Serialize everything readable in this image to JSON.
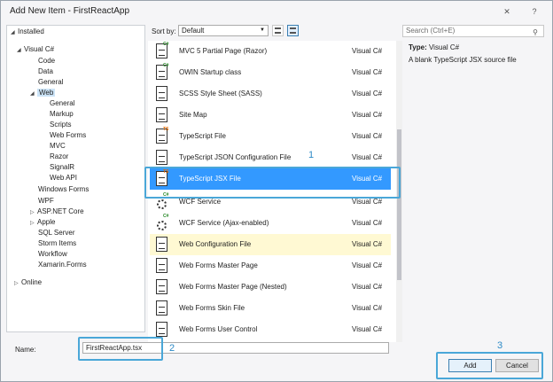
{
  "window": {
    "title": "Add New Item - FirstReactApp",
    "close_icon": "close-icon",
    "help_label": "?"
  },
  "tree": {
    "installed": "Installed",
    "visual_csharp": "Visual C#",
    "items_level2": [
      "Code",
      "Data",
      "General"
    ],
    "web": "Web",
    "web_children": [
      "General",
      "Markup",
      "Scripts",
      "Web Forms",
      "MVC",
      "Razor",
      "SignalR",
      "Web API"
    ],
    "items_after_web": [
      "Windows Forms",
      "WPF"
    ],
    "asp_net_core": "ASP.NET Core",
    "apple": "Apple",
    "items_tail": [
      "SQL Server",
      "Storm Items",
      "Workflow",
      "Xamarin.Forms"
    ],
    "online": "Online"
  },
  "toolbar": {
    "sort_label": "Sort by:",
    "sort_value": "Default"
  },
  "templates": [
    {
      "name": "MVC 5 Partial Page (Razor)",
      "lang": "Visual C#"
    },
    {
      "name": "OWIN Startup class",
      "lang": "Visual C#"
    },
    {
      "name": "SCSS Style Sheet (SASS)",
      "lang": "Visual C#"
    },
    {
      "name": "Site Map",
      "lang": "Visual C#"
    },
    {
      "name": "TypeScript File",
      "lang": "Visual C#"
    },
    {
      "name": "TypeScript JSON Configuration File",
      "lang": "Visual C#"
    },
    {
      "name": "TypeScript JSX File",
      "lang": "Visual C#"
    },
    {
      "name": "WCF Service",
      "lang": "Visual C#"
    },
    {
      "name": "WCF Service (Ajax-enabled)",
      "lang": "Visual C#"
    },
    {
      "name": "Web Configuration File",
      "lang": "Visual C#"
    },
    {
      "name": "Web Forms Master Page",
      "lang": "Visual C#"
    },
    {
      "name": "Web Forms Master Page (Nested)",
      "lang": "Visual C#"
    },
    {
      "name": "Web Forms Skin File",
      "lang": "Visual C#"
    },
    {
      "name": "Web Forms User Control",
      "lang": "Visual C#"
    }
  ],
  "badges": {
    "ts": "TS",
    "cs": "C#"
  },
  "search": {
    "placeholder": "Search (Ctrl+E)"
  },
  "info": {
    "type_label": "Type:",
    "type_value": "Visual C#",
    "description": "A blank TypeScript JSX source file"
  },
  "bottom": {
    "name_label": "Name:",
    "name_value": "FirstReactApp.tsx",
    "add_label": "Add",
    "cancel_label": "Cancel"
  },
  "annotations": {
    "one": "1",
    "two": "2",
    "three": "3"
  },
  "colors": {
    "selected": "#3399ff",
    "highlight": "#4aa7d8",
    "hover": "#fff9d3"
  }
}
